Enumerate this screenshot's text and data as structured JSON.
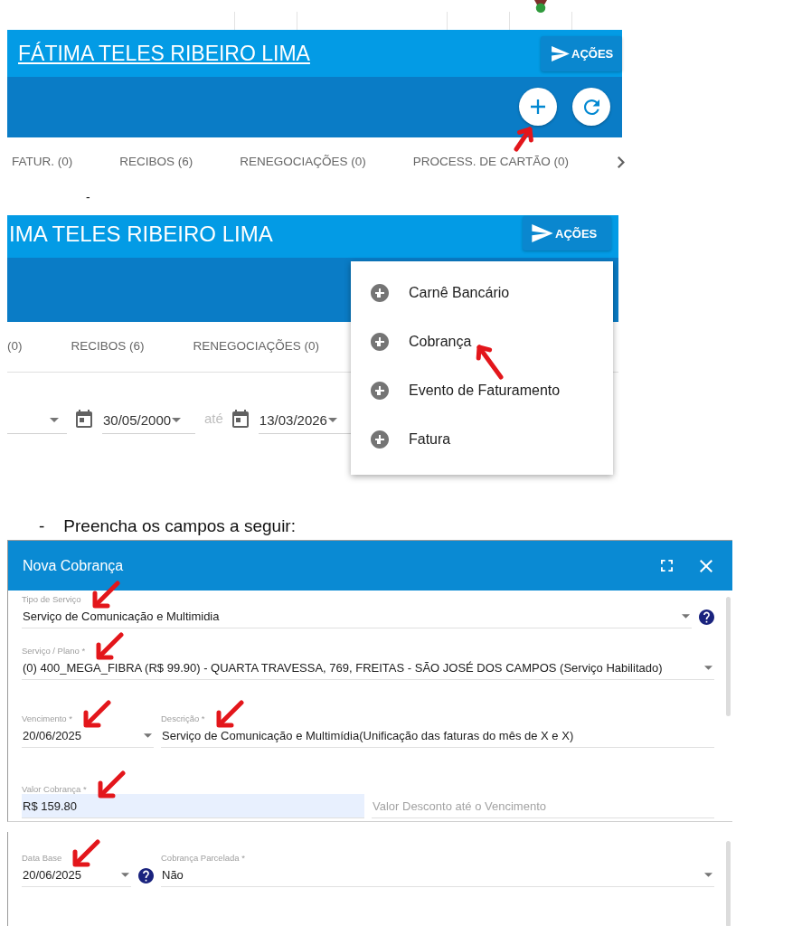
{
  "top_capture": {
    "customer_name": "FÁTIMA TELES RIBEIRO LIMA",
    "is_link": true,
    "actions_button": "AÇÕES",
    "toolbar_buttons": [
      {
        "kind": "add",
        "pointer_arrow": true
      },
      {
        "kind": "refresh",
        "pointer_arrow": false
      }
    ],
    "tabs": [
      {
        "label": "FATUR. (0)",
        "selected": false
      },
      {
        "label": "RECIBOS (6)",
        "selected": false
      },
      {
        "label": "RENEGOCIAÇÕES (0)",
        "selected": false
      },
      {
        "label": "PROCESS. DE CARTÃO (0)",
        "selected": false
      }
    ]
  },
  "list_dash": "-",
  "menu_capture": {
    "customer_name": "IMA TELES RIBEIRO LIMA",
    "is_link": false,
    "actions_button": "AÇÕES",
    "tabs": [
      {
        "label": "(0)",
        "selected": false
      },
      {
        "label": "RECIBOS (6)",
        "selected": false
      },
      {
        "label": "RENEGOCIAÇÕES (0)",
        "selected": false
      }
    ],
    "filters": [
      {
        "kind": "select"
      },
      {
        "kind": "date",
        "value": "30/05/2000"
      },
      {
        "kind": "label",
        "text": "até"
      },
      {
        "kind": "date",
        "value": "13/03/2026"
      }
    ],
    "menu": [
      {
        "label": "Carnê Bancário",
        "pointer_arrow": false
      },
      {
        "label": "Cobrança",
        "pointer_arrow": true
      },
      {
        "label": "Evento de Faturamento",
        "pointer_arrow": false
      },
      {
        "label": "Fatura",
        "pointer_arrow": false
      }
    ]
  },
  "instruction": {
    "bullet": "-",
    "text": "Preencha os campos a seguir:"
  },
  "dialog": {
    "title": "Nova Cobrança",
    "rows": [
      [
        {
          "kind": "select",
          "label": "Tipo de Serviço",
          "value": "Serviço de Comunicação e Multimidia",
          "help": true,
          "highlighted": false,
          "pointer_arrow": true
        }
      ],
      [
        {
          "kind": "select",
          "label": "Serviço / Plano *",
          "value": "(0) 400_MEGA_FIBRA (R$ 99.90) - QUARTA TRAVESSA, 769, FREITAS - SÃO JOSÉ DOS CAMPOS (Serviço Habilitado)",
          "help": false,
          "highlighted": false,
          "pointer_arrow": true
        }
      ],
      [
        {
          "kind": "date",
          "label": "Vencimento *",
          "value": "20/06/2025",
          "help": false,
          "highlighted": false,
          "pointer_arrow": true
        },
        {
          "kind": "text",
          "label": "Descrição *",
          "value": "Serviço de Comunicação e Multimídia(Unificação das faturas do mês de X e X)",
          "help": false,
          "highlighted": false,
          "pointer_arrow": true
        }
      ],
      [
        {
          "kind": "text",
          "label": "Valor Cobrança *",
          "value": "R$ 159.80",
          "help": false,
          "highlighted": true,
          "pointer_arrow": true
        },
        {
          "kind": "text",
          "placeholder": "Valor Desconto até o Vencimento",
          "help": false,
          "highlighted": false,
          "pointer_arrow": false
        }
      ]
    ]
  },
  "dialog_continued": {
    "rows": [
      [
        {
          "kind": "date",
          "label": "Data Base",
          "value": "20/06/2025",
          "help": true,
          "highlighted": false,
          "pointer_arrow": true
        },
        {
          "kind": "select",
          "label": "Cobrança Parcelada *",
          "value": "Não",
          "help": false,
          "highlighted": false,
          "pointer_arrow": false
        }
      ]
    ]
  }
}
